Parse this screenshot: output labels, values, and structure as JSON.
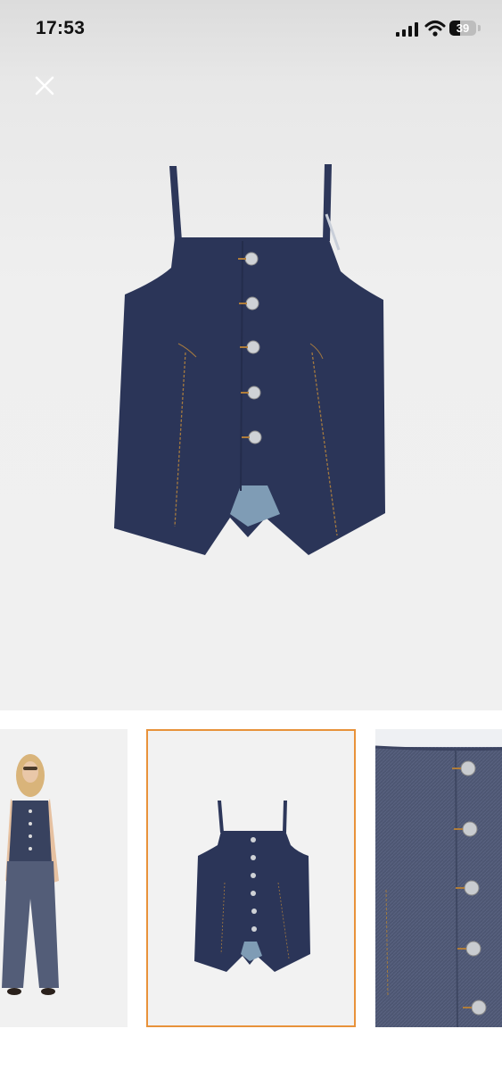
{
  "status_bar": {
    "time": "17:53",
    "battery_level": "39",
    "icons": [
      "signal-icon",
      "wifi-icon",
      "battery-icon"
    ]
  },
  "viewer": {
    "close_icon": "close-icon",
    "main_image": "denim-button-front-top-product-image",
    "selected_thumbnail": 2
  },
  "thumbnails": [
    {
      "name": "model-wearing-denim-outfit",
      "selected": false
    },
    {
      "name": "denim-top-product",
      "selected": true
    },
    {
      "name": "denim-buttons-detail",
      "selected": false
    }
  ],
  "colors": {
    "denim": "#2b3558",
    "denim_detail": "#4d5672",
    "selection_border": "#e8923a",
    "background": "#f0f0f0"
  }
}
